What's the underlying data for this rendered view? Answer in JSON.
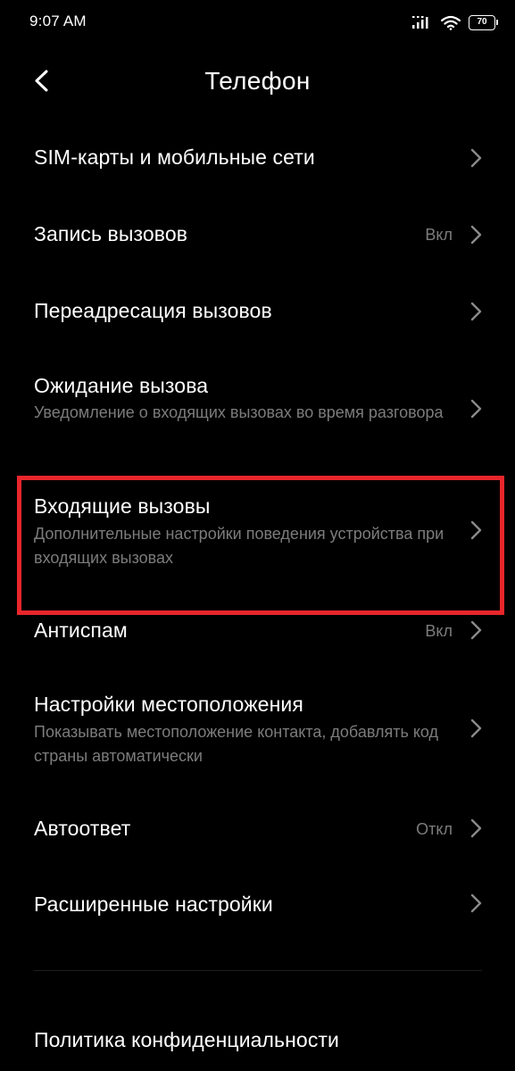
{
  "status_bar": {
    "time": "9:07 AM",
    "battery": "70",
    "icons": [
      "signal-icon",
      "wifi-icon",
      "battery-icon"
    ]
  },
  "header": {
    "title": "Телефон",
    "back_icon": "back-arrow-icon"
  },
  "items": [
    {
      "title": "SIM-карты и мобильные сети",
      "subtitle": "",
      "value": ""
    },
    {
      "title": "Запись вызовов",
      "subtitle": "",
      "value": "Вкл"
    },
    {
      "title": "Переадресация вызовов",
      "subtitle": "",
      "value": ""
    },
    {
      "title": "Ожидание вызова",
      "subtitle": "Уведомление о входящих вызовах во время разговора",
      "value": ""
    },
    {
      "title": "Входящие вызовы",
      "subtitle": "Дополнительные настройки поведения устройства при входящих вызовах",
      "value": ""
    },
    {
      "title": "Антиспам",
      "subtitle": "",
      "value": "Вкл"
    },
    {
      "title": "Настройки местоположения",
      "subtitle": "Показывать местоположение контакта, добавлять код страны автоматически",
      "value": ""
    },
    {
      "title": "Автоответ",
      "subtitle": "",
      "value": "Откл"
    },
    {
      "title": "Расширенные настройки",
      "subtitle": "",
      "value": ""
    },
    {
      "title": "Политика конфиденциальности",
      "subtitle": "",
      "value": ""
    }
  ],
  "colors": {
    "background": "#000000",
    "primary_text": "#ffffff",
    "secondary_text": "#7c7c7c",
    "highlight": "#e8262b"
  }
}
